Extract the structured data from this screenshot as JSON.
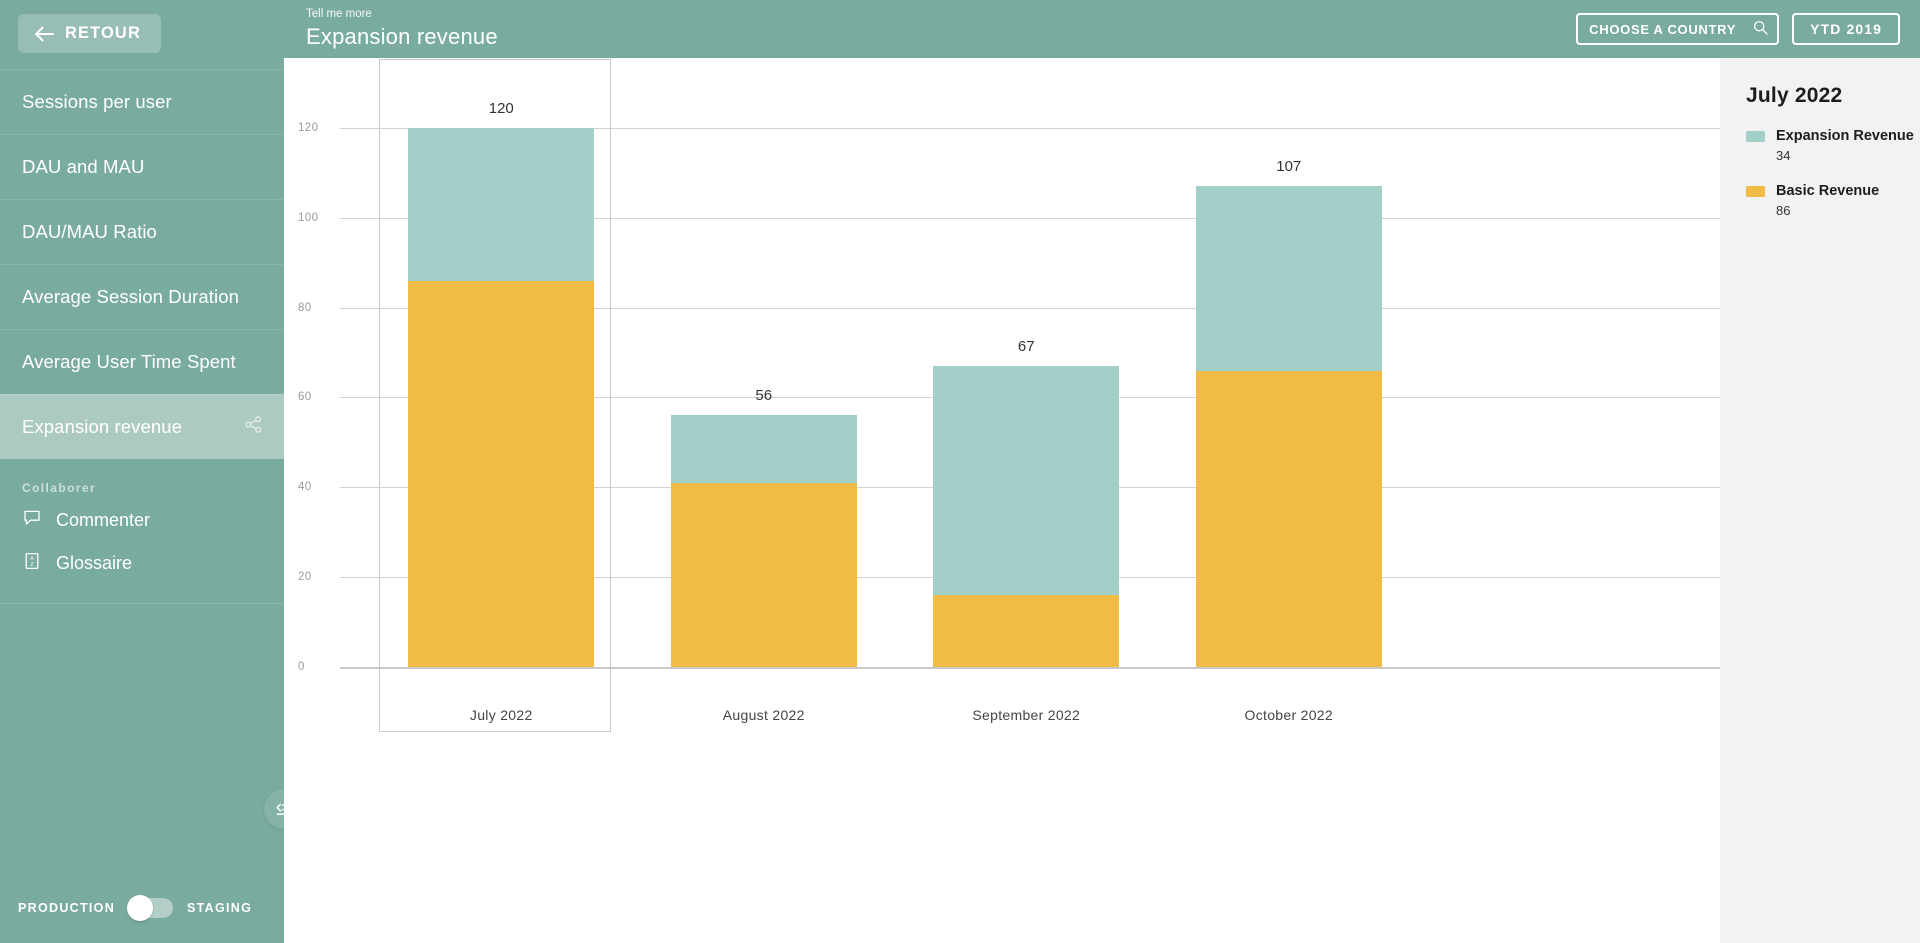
{
  "sidebar": {
    "back_button": {
      "label": "RETOUR",
      "icon": "arrow-left-icon"
    },
    "items": [
      {
        "label": "Sessions per user",
        "active": false
      },
      {
        "label": "DAU and MAU",
        "active": false
      },
      {
        "label": "DAU/MAU Ratio",
        "active": false
      },
      {
        "label": "Average Session Duration",
        "active": false
      },
      {
        "label": "Average User Time Spent",
        "active": false
      },
      {
        "label": "Expansion revenue",
        "active": true,
        "icon": "share-icon"
      }
    ],
    "collab_header": "Collaborer",
    "collab_items": [
      {
        "label": "Commenter",
        "icon": "comment-icon"
      },
      {
        "label": "Glossaire",
        "icon": "glossary-book-icon"
      }
    ],
    "collapse_button": {
      "icon": "collapse-sidebar-icon"
    },
    "environment": {
      "left_label": "PRODUCTION",
      "right_label": "STAGING",
      "selected": "PRODUCTION"
    }
  },
  "header": {
    "kicker": "Tell me more",
    "title": "Expansion revenue",
    "country_select": {
      "value": "CHOOSE A COUNTRY",
      "icon": "search-icon"
    },
    "period_button": {
      "label": "YTD 2019"
    }
  },
  "legend_panel": {
    "title": "July 2022",
    "rows": [
      {
        "name": "Expansion Revenue",
        "value": "34",
        "color": "#a3cfc9"
      },
      {
        "name": "Basic Revenue",
        "value": "86",
        "color": "#f0bc46"
      }
    ]
  },
  "colors": {
    "sidebar_green": "#7aab9f",
    "sidebar_active": "#adcac2",
    "expansion_revenue": "#a3cfc9",
    "basic_revenue": "#f0bc46",
    "panel_bg": "#f2f2f2",
    "gridline": "#d2d2d2"
  },
  "chart_data": {
    "type": "bar",
    "stacked": true,
    "title": "Expansion revenue",
    "xlabel": "",
    "ylabel": "",
    "ylim": [
      0,
      128
    ],
    "yticks": [
      0,
      20,
      40,
      60,
      80,
      100,
      120
    ],
    "grid": true,
    "legend_position": "right",
    "categories": [
      "July 2022",
      "August 2022",
      "September 2022",
      "October 2022"
    ],
    "series": [
      {
        "name": "Basic Revenue",
        "color": "#f0bc46",
        "values": [
          86,
          41,
          16,
          66
        ]
      },
      {
        "name": "Expansion Revenue",
        "color": "#a3cfc9",
        "values": [
          34,
          15,
          51,
          41
        ]
      }
    ],
    "totals": [
      120,
      56,
      67,
      107
    ],
    "total_labels": [
      "120",
      "56",
      "67",
      "107"
    ],
    "tick_labels": [
      "0",
      "20",
      "40",
      "60",
      "80",
      "100",
      "120"
    ],
    "selected_category": "July 2022"
  }
}
